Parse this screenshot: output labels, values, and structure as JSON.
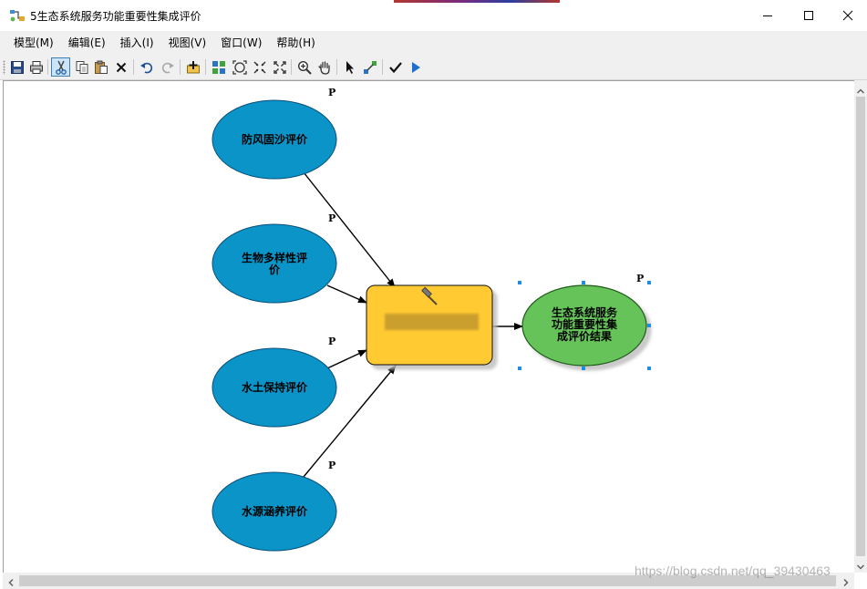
{
  "window": {
    "title": "5生态系统服务功能重要性集成评价",
    "controls": [
      "minimize-icon",
      "maximize-icon",
      "close-icon"
    ]
  },
  "menu": {
    "items": [
      {
        "label": "模型(M)"
      },
      {
        "label": "编辑(E)"
      },
      {
        "label": "插入(I)"
      },
      {
        "label": "视图(V)"
      },
      {
        "label": "窗口(W)"
      },
      {
        "label": "帮助(H)"
      }
    ]
  },
  "toolbar": {
    "buttons": [
      {
        "icon": "save-icon"
      },
      {
        "icon": "print-icon"
      },
      {
        "icon": "cut-icon",
        "active": true
      },
      {
        "icon": "copy-icon"
      },
      {
        "icon": "paste-icon"
      },
      {
        "icon": "delete-icon"
      },
      {
        "icon": "undo-icon"
      },
      {
        "icon": "redo-icon"
      },
      {
        "icon": "add-data-icon"
      },
      {
        "icon": "auto-layout-icon"
      },
      {
        "icon": "full-extent-icon"
      },
      {
        "icon": "zoom-in-fixed-icon"
      },
      {
        "icon": "zoom-out-fixed-icon"
      },
      {
        "icon": "zoom-in-icon"
      },
      {
        "icon": "pan-icon"
      },
      {
        "icon": "select-icon"
      },
      {
        "icon": "connect-icon"
      },
      {
        "icon": "validate-icon"
      },
      {
        "icon": "run-icon"
      }
    ]
  },
  "diagram": {
    "inputs": [
      {
        "label_lines": [
          "防风固沙评价"
        ],
        "param": "P"
      },
      {
        "label_lines": [
          "生物多样性评",
          "价"
        ],
        "param": "P"
      },
      {
        "label_lines": [
          "水土保持评价"
        ],
        "param": "P"
      },
      {
        "label_lines": [
          "水源涵养评价"
        ],
        "param": "P"
      }
    ],
    "tool": {
      "label": "",
      "icon": "hammer-icon"
    },
    "output": {
      "label_lines": [
        "生态系统服务",
        "功能重要性集",
        "成评价结果"
      ],
      "param": "P"
    },
    "colors": {
      "input_fill": "#0a94c8",
      "tool_fill": "#ffca33",
      "output_fill": "#66c35a",
      "selection_handle": "#1e8fe0"
    }
  },
  "watermark": "https://blog.csdn.net/qq_39430463"
}
